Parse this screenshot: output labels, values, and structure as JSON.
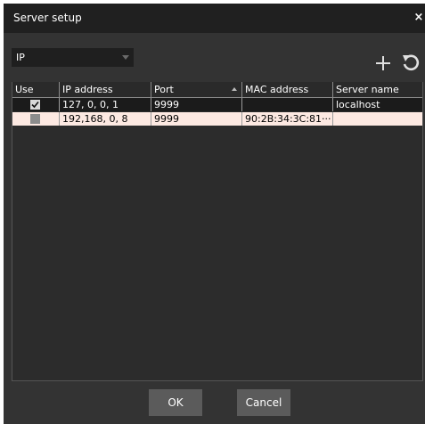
{
  "window": {
    "title": "Server setup",
    "close_glyph": "×"
  },
  "filter": {
    "selected": "IP"
  },
  "toolbar": {
    "add_icon": "plus-icon",
    "refresh_icon": "refresh-icon"
  },
  "table": {
    "columns": [
      "Use",
      "IP address",
      "Port",
      "MAC address",
      "Server name"
    ],
    "sorted_column": "Port",
    "rows": [
      {
        "use": true,
        "ip": "127,  0,  0,  1",
        "port": "9999",
        "mac": "",
        "name": "localhost"
      },
      {
        "use": false,
        "ip": "192,168,   0,   8",
        "port": "9999",
        "mac": "90:2B:34:3C:81···",
        "name": ""
      }
    ]
  },
  "buttons": {
    "ok": "OK",
    "cancel": "Cancel"
  },
  "colors": {
    "window_bg": "#333333",
    "titlebar_bg": "#202020",
    "selected_row_bg": "#fde9e2",
    "button_bg": "#5b5b5b"
  }
}
